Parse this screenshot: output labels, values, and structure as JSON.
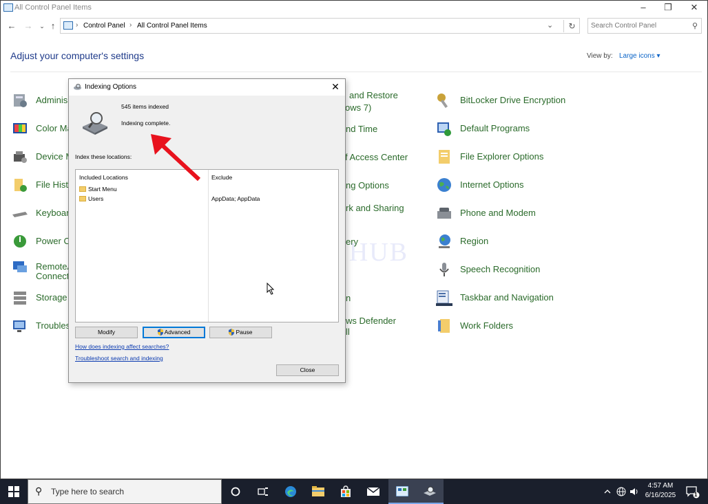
{
  "window": {
    "title": "All Control Panel Items"
  },
  "address": {
    "crumbs": [
      "Control Panel",
      "All Control Panel Items"
    ],
    "search_placeholder": "Search Control Panel"
  },
  "header": {
    "heading": "Adjust your computer's settings",
    "view_by_label": "View by:",
    "view_by_value": "Large icons"
  },
  "items_col1": [
    "Adminis",
    "Color Ma",
    "Device M",
    "File Histo",
    "Keyboar",
    "Power O",
    "RemoteA",
    "Storage",
    "Troubles"
  ],
  "items_col1_extra": [
    "Connect"
  ],
  "items_col2": [
    "and Restore",
    "ows 7)",
    "nd Time",
    "f Access Center",
    "ng Options",
    "rk and Sharing",
    "ery",
    "n",
    "ws Defender",
    "ll"
  ],
  "items_col3": [
    "BitLocker Drive Encryption",
    "Default Programs",
    "File Explorer Options",
    "Internet Options",
    "Phone and Modem",
    "Region",
    "Speech Recognition",
    "Taskbar and Navigation",
    "Work Folders"
  ],
  "dialog": {
    "title": "Indexing Options",
    "items_indexed": "545 items indexed",
    "status": "Indexing complete.",
    "index_label": "Index these locations:",
    "col_included": "Included Locations",
    "col_exclude": "Exclude",
    "locations": [
      "Start Menu",
      "Users"
    ],
    "exclude_value": "AppData; AppData",
    "btn_modify": "Modify",
    "btn_advanced": "Advanced",
    "btn_pause": "Pause",
    "link_affect": "How does indexing affect searches?",
    "link_troubleshoot": "Troubleshoot search and indexing",
    "btn_close": "Close"
  },
  "watermark": "IT Pros HUB",
  "taskbar": {
    "search_placeholder": "Type here to search",
    "time": "4:57 AM",
    "date": "6/16/2025",
    "notifications": "1"
  },
  "colors": {
    "accent": "#0078d7",
    "link": "#2a6a2a",
    "arrow": "#e8121d"
  }
}
